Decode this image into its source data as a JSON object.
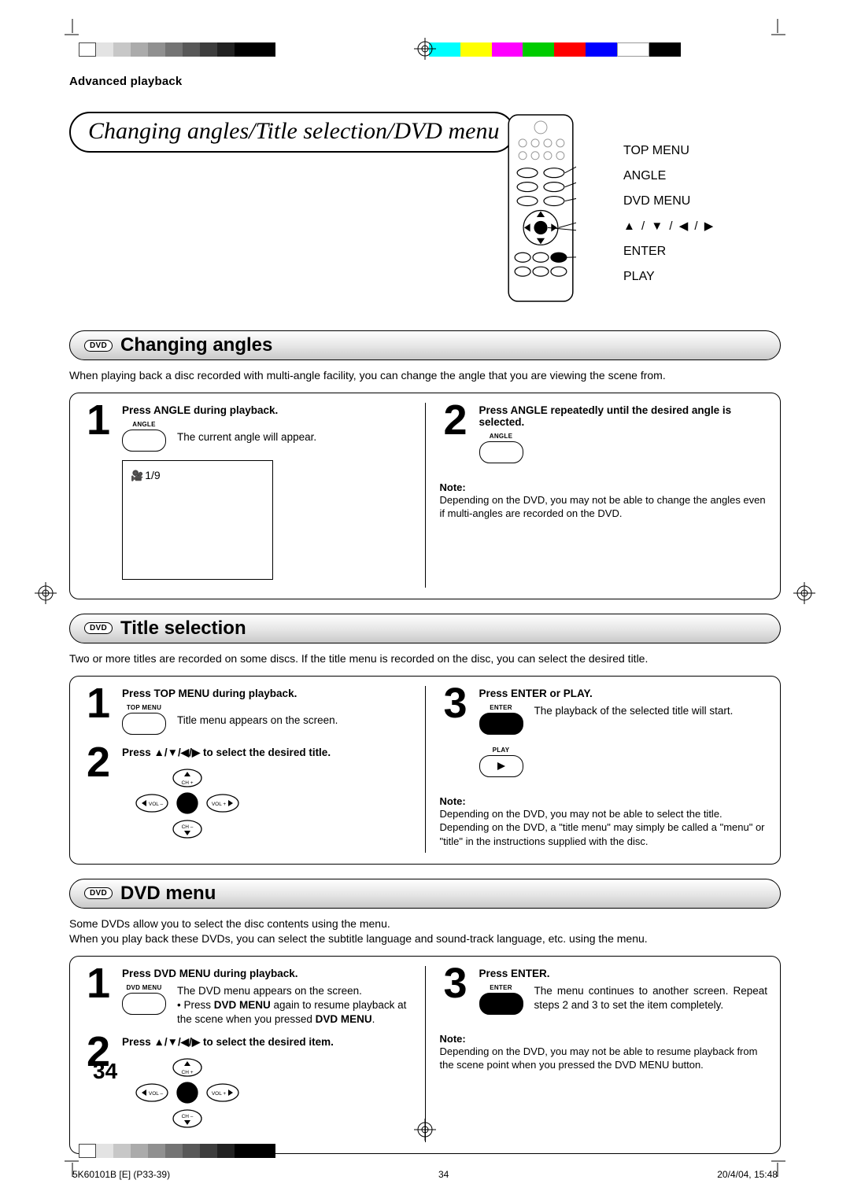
{
  "header": {
    "section_label": "Advanced playback"
  },
  "page_title": "Changing angles/Title selection/DVD menu",
  "remote_labels": [
    "TOP MENU",
    "ANGLE",
    "DVD MENU",
    "▲ / ▼ / ◀ / ▶",
    "ENTER",
    "PLAY"
  ],
  "badge": "DVD",
  "sections": {
    "angles": {
      "title": "Changing angles",
      "intro": "When playing back a disc recorded with multi-angle facility, you can change the angle that you are viewing the scene from.",
      "step1": {
        "title": "Press ANGLE during playback.",
        "text": "The current angle will appear.",
        "btn_label": "ANGLE",
        "screen_text": "1/9"
      },
      "step2": {
        "title": "Press ANGLE repeatedly until the desired angle is selected.",
        "btn_label": "ANGLE"
      },
      "note_h": "Note:",
      "note_t": "Depending on the DVD, you may not be able to change the angles even if multi-angles are recorded on the DVD."
    },
    "title_sel": {
      "title": "Title selection",
      "intro": "Two or more titles are recorded on some discs. If the title menu is recorded on the disc, you can select the desired title.",
      "step1": {
        "title": "Press TOP MENU during playback.",
        "text": "Title menu appears on the screen.",
        "btn_label": "TOP MENU"
      },
      "step2": {
        "title": "Press ▲/▼/◀/▶ to select the desired title."
      },
      "step3": {
        "title": "Press ENTER or PLAY.",
        "text": "The playback of the selected title will start.",
        "btn1_label": "ENTER",
        "btn2_label": "PLAY"
      },
      "note_h": "Note:",
      "note_t": "Depending on the DVD, you may not be able to select the title. Depending on the DVD, a \"title menu\" may simply be called a \"menu\" or \"title\" in the instructions supplied with the disc."
    },
    "dvd_menu": {
      "title": "DVD menu",
      "intro1": "Some DVDs allow you to select the disc contents using the menu.",
      "intro2": "When you play back these DVDs, you can select the subtitle language and sound-track language, etc. using the menu.",
      "step1": {
        "title": "Press DVD MENU during playback.",
        "text1": "The DVD menu appears on the screen.",
        "bullet_pre": "Press ",
        "bullet_bold": "DVD MENU",
        "bullet_mid": " again to resume playback at the scene when you pressed ",
        "bullet_bold2": "DVD MENU",
        "bullet_end": ".",
        "btn_label": "DVD MENU"
      },
      "step2": {
        "title": "Press ▲/▼/◀/▶ to select the desired item."
      },
      "step3": {
        "title": "Press ENTER.",
        "text": "The menu continues to another screen. Repeat steps 2 and 3 to set the item completely.",
        "btn_label": "ENTER"
      },
      "note_h": "Note:",
      "note_t": "Depending on the DVD, you may not be able to resume playback from the scene point when you pressed the DVD MENU button."
    }
  },
  "page_number": "34",
  "footer": {
    "left": "5K60101B [E] (P33-39)",
    "center": "34",
    "right": "20/4/04, 15:48"
  },
  "dpad_labels": {
    "up": "CH +",
    "down": "CH –",
    "left": "VOL –",
    "right": "VOL +"
  }
}
